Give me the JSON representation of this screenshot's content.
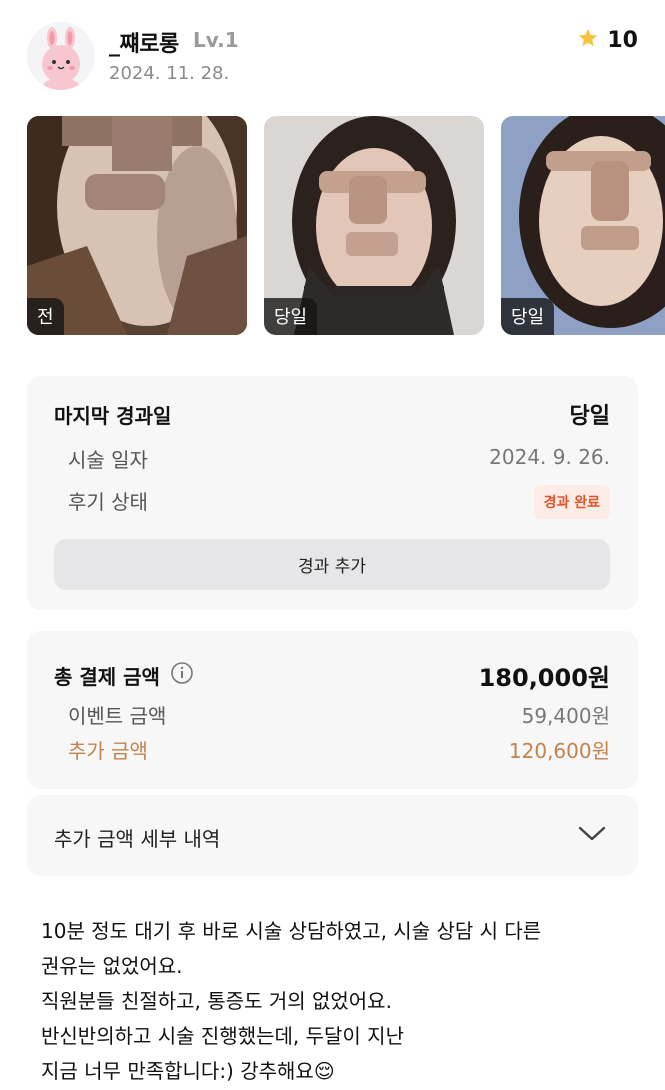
{
  "user": {
    "name": "_쨰로롱",
    "level": "Lv.1",
    "date": "2024. 11. 28.",
    "rating": "10",
    "avatar_icon": "bunny-avatar-icon",
    "rating_icon": "star-icon"
  },
  "photos": [
    {
      "label": "전"
    },
    {
      "label": "당일"
    },
    {
      "label": "당일"
    }
  ],
  "progress": {
    "title": "마지막 경과일",
    "value": "당일",
    "procedure_date_label": "시술 일자",
    "procedure_date": "2024. 9. 26.",
    "status_label": "후기 상태",
    "status": "경과 완료",
    "add_button": "경과 추가"
  },
  "payment": {
    "total_label": "총 결제 금액",
    "total": "180,000원",
    "event_label": "이벤트 금액",
    "event": "59,400원",
    "extra_label": "추가 금액",
    "extra": "120,600원",
    "info_icon": "info-icon"
  },
  "details": {
    "label": "추가 금액 세부 내역",
    "chevron_icon": "chevron-down-icon"
  },
  "review": {
    "lines": [
      "10분 정도 대기 후 바로 시술 상담하였고, 시술 상담 시 다른",
      "권유는 없었어요.",
      "직원분들 친절하고, 통증도 거의 없었어요.",
      "반신반의하고 시술 진행했는데, 두달이 지난",
      "지금 너무 만족합니다:) 강추해요"
    ],
    "emoji": "😌"
  },
  "colors": {
    "card_bg": "#f7f7f8",
    "badge_bg": "#fdece6",
    "badge_text": "#e0542a",
    "extra_amount": "#c0834a",
    "star": "#f6c343"
  }
}
